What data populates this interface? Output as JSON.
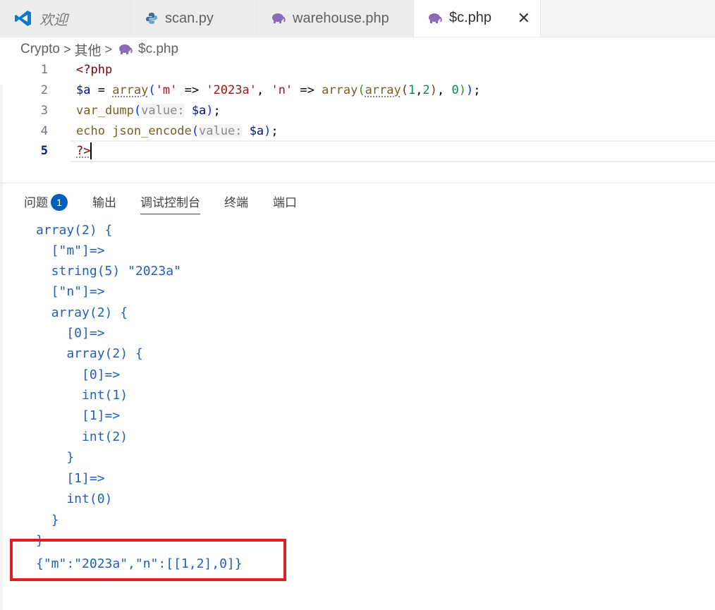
{
  "tabs": [
    {
      "label": "欢迎",
      "icon": "vscode-logo-icon"
    },
    {
      "label": "scan.py",
      "icon": "python-icon"
    },
    {
      "label": "warehouse.php",
      "icon": "php-elephant-icon"
    },
    {
      "label": "$c.php",
      "icon": "php-elephant-icon",
      "close": "✕"
    }
  ],
  "breadcrumb": {
    "root": "Crypto",
    "folder": "其他",
    "file": "$c.php",
    "sep": ">"
  },
  "editor": {
    "line_numbers": [
      "1",
      "2",
      "3",
      "4",
      "5"
    ],
    "l1": "<?php",
    "l2": {
      "var": "$a",
      "eq": " = ",
      "array": "array",
      "open": "(",
      "m": "'m'",
      "arrow1": " => ",
      "v2023": "'2023a'",
      "comma1": ", ",
      "n": "'n'",
      "arrow2": " => ",
      "array2": "array",
      "open2": "(",
      "array3": "array",
      "open3": "(",
      "one": "1",
      "comma2": ",",
      "two": "2",
      "close3": ")",
      "comma3": ", ",
      "zero": "0",
      "close2": ")",
      "close1": ")",
      "semi": ";"
    },
    "l3": {
      "fn": "var_dump",
      "open": "(",
      "hint": "value:",
      "sp": " ",
      "var": "$a",
      "close": ")",
      "semi": ";"
    },
    "l4": {
      "fn": "echo json_encode",
      "open": "(",
      "hint": "value:",
      "sp": " ",
      "var": "$a",
      "close": ")",
      "semi": ";"
    },
    "l5": "?>"
  },
  "panel": {
    "tabs": [
      "问题",
      "输出",
      "调试控制台",
      "终端",
      "端口"
    ],
    "problem_count": "1",
    "active_tab": "调试控制台"
  },
  "console": [
    "array(2) {",
    "  [\"m\"]=>",
    "  string(5) \"2023a\"",
    "  [\"n\"]=>",
    "  array(2) {",
    "    [0]=>",
    "    array(2) {",
    "      [0]=>",
    "      int(1)",
    "      [1]=>",
    "      int(2)",
    "    }",
    "    [1]=>",
    "    int(0)",
    "  }",
    "}",
    "{\"m\":\"2023a\",\"n\":[[1,2],0]}"
  ],
  "colors": {
    "highlight_box": "#e02020",
    "badge": "#005fb8",
    "console_text": "#1f5fbf"
  }
}
